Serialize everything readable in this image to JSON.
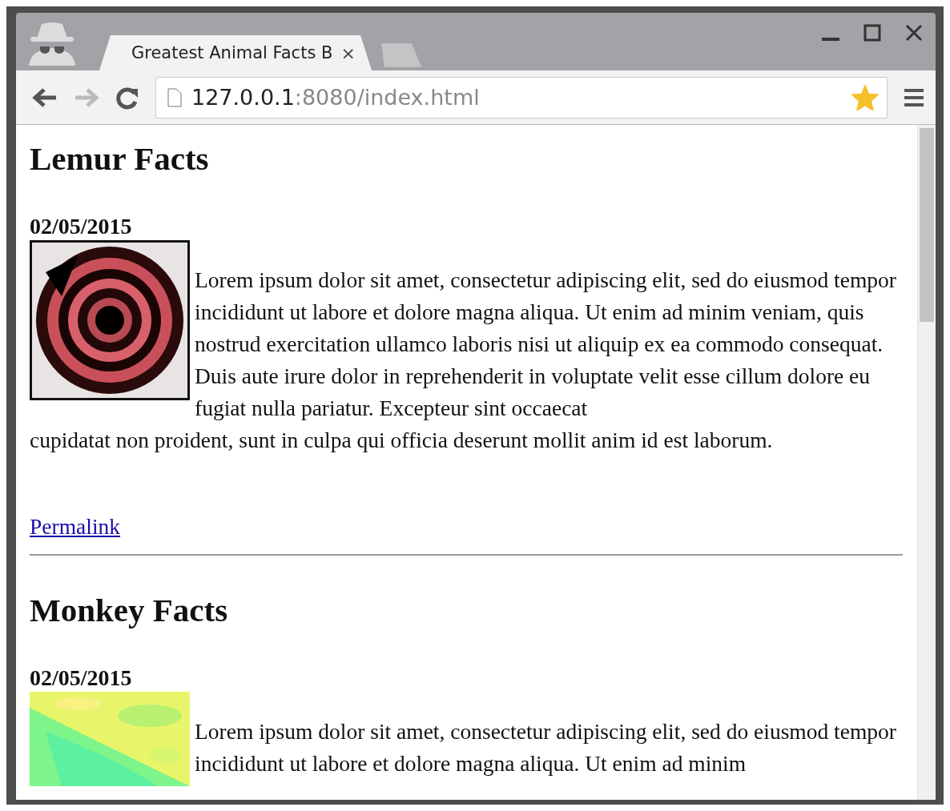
{
  "browser": {
    "tab": {
      "title": "Greatest Animal Facts B",
      "close": "×",
      "selected": true
    },
    "address": {
      "host": "127.0.0.1",
      "path": ":8080/index.html"
    },
    "bookmarked": true
  },
  "articles": [
    {
      "title": "Lemur Facts",
      "date": "02/05/2015",
      "body": [
        "Lorem ipsum dolor sit amet, consectetur adipiscing elit, sed do eiusmod tempor incididunt ut labore et dolore magna aliqua. Ut enim ad minim veniam, quis nostrud exercitation ullamco laboris nisi ut aliquip ex ea commodo consequat. Duis aute irure dolor in reprehenderit in voluptate velit esse cillum dolore eu fugiat nulla pariatur. Excepteur sint occaecat",
        "cupidatat non proident, sunt in culpa qui officia deserunt mollit anim id est laborum."
      ],
      "link": "Permalink"
    },
    {
      "title": "Monkey Facts",
      "date": "02/05/2015",
      "body": [
        "Lorem ipsum dolor sit amet, consectetur adipiscing elit, sed do eiusmod tempor incididunt ut labore et dolore magna aliqua. Ut enim ad minim"
      ]
    }
  ]
}
